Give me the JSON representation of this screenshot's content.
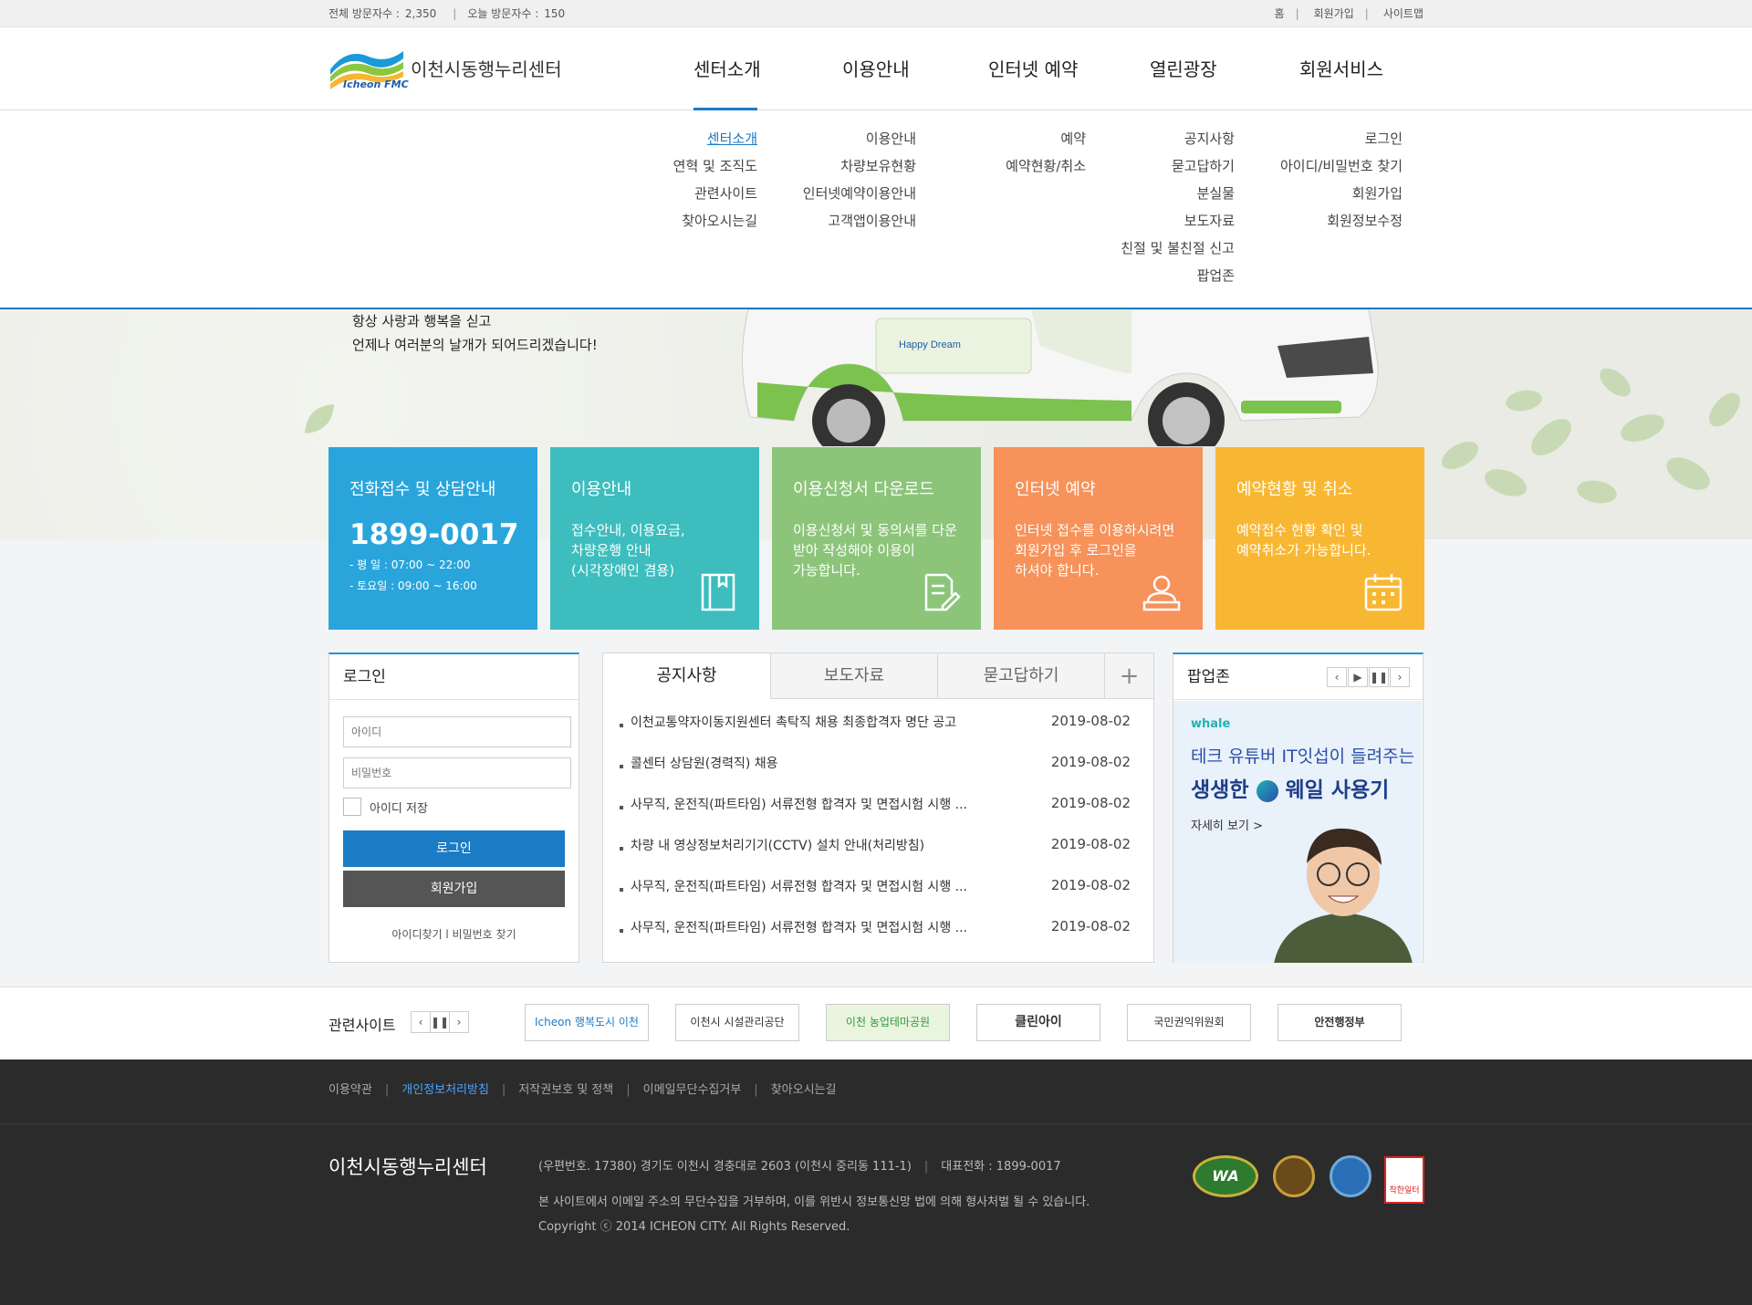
{
  "topbar": {
    "total_visitors_label": "전체 방문자수 :",
    "total_visitors": "2,350",
    "today_visitors_label": "오늘 방문자수 :",
    "today_visitors": "150",
    "links": [
      "홈",
      "회원가입",
      "사이트맵"
    ]
  },
  "header": {
    "logo_en": "Icheon FMC",
    "logo_ko": "이천시동행누리센터",
    "nav": [
      "센터소개",
      "이용안내",
      "인터넷 예약",
      "열린광장",
      "회원서비스"
    ]
  },
  "submenu": {
    "col1": [
      "센터소개",
      "연혁 및 조직도",
      "관련사이트",
      "찾아오시는길"
    ],
    "col2": [
      "이용안내",
      "차량보유현황",
      "인터넷예약이용안내",
      "고객앱이용안내"
    ],
    "col3": [
      "예약",
      "예약현황/취소"
    ],
    "col4": [
      "공지사항",
      "묻고답하기",
      "분실물",
      "보도자료",
      "친절 및 불친절 신고",
      "팝업존"
    ],
    "col5": [
      "로그인",
      "아이디/비밀번호 찾기",
      "회원가입",
      "회원정보수정"
    ]
  },
  "visual": {
    "line1": "항상 사랑과 행복을 싣고",
    "line2": "언제나 여러분의 날개가 되어드리겠습니다!",
    "car_badge": "Happy Dream"
  },
  "quick": {
    "phone_box": {
      "title": "전화접수 및 상담안내",
      "phone": "1899-0017",
      "weekday": "- 평    일 : 07:00 ~ 22:00",
      "saturday": "- 토요일 : 09:00 ~ 16:00",
      "color": "#2aa5dc"
    },
    "guide_box": {
      "title": "이용안내",
      "desc": [
        "접수안내, 이용요금,",
        "차량운행 안내",
        "(시각장애인 겸용)"
      ],
      "color": "#3dbdbd"
    },
    "download_box": {
      "title": "이용신청서 다운로드",
      "desc": [
        "이용신청서 및 동의서를 다운",
        "받아 작성해야 이용이",
        "가능합니다."
      ],
      "color": "#8cc57a"
    },
    "reserve_box": {
      "title": "인터넷 예약",
      "desc": [
        "인터넷 접수를 이용하시려면",
        "회원가입 후 로그인을",
        "하셔야 합니다."
      ],
      "color": "#f6925a"
    },
    "status_box": {
      "title": "예약현황 및 취소",
      "desc": [
        "예약접수 현황 확인 및",
        "예약취소가 가능합니다."
      ],
      "color": "#f8b733"
    }
  },
  "login": {
    "title": "로그인",
    "id_placeholder": "아이디",
    "pw_placeholder": "비밀번호",
    "save_id": "아이디 저장",
    "login_btn": "로그인",
    "join_btn": "회원가입",
    "find": "아이디찾기 l 비밀번호 찾기"
  },
  "board": {
    "tabs": [
      "공지사항",
      "보도자료",
      "묻고답하기",
      "+"
    ],
    "items": [
      {
        "title": "이천교통약자이동지원센터 촉탁직 채용 최종합격자 명단 공고",
        "date": "2019-08-02"
      },
      {
        "title": "콜센터 상담원(경력직) 채용",
        "date": "2019-08-02"
      },
      {
        "title": "사무직, 운전직(파트타임) 서류전형 합격자 및 면접시험 시행 ...",
        "date": "2019-08-02"
      },
      {
        "title": "차량 내 영상정보처리기기(CCTV) 설치 안내(처리방침)",
        "date": "2019-08-02"
      },
      {
        "title": "사무직, 운전직(파트타임) 서류전형 합격자 및 면접시험 시행 ...",
        "date": "2019-08-02"
      },
      {
        "title": "사무직, 운전직(파트타임) 서류전형 합격자 및 면접시험 시행 ...",
        "date": "2019-08-02"
      }
    ]
  },
  "popup": {
    "title": "팝업존",
    "brand": "whale",
    "headline1": "테크 유튜버 IT잇섭이 들려주는",
    "headline2a": "생생한",
    "headline2b": "웨일 사용기",
    "more": "자세히 보기 >"
  },
  "related": {
    "label": "관련사이트",
    "banners": [
      "Icheon 행복도시 이천",
      "이천시 시설관리공단",
      "이천 농업테마공원",
      "클린아이",
      "국민권익위원회",
      "안전행정부"
    ]
  },
  "footer": {
    "links": [
      "이용약관",
      "개인정보처리방침",
      "저작권보호 및 정책",
      "이메일무단수집거부",
      "찾아오시는길"
    ],
    "name": "이천시동행누리센터",
    "address": "(우편번호. 17380) 경기도 이천시 경충대로 2603 (이천시 중리동 111-1)",
    "phone": "대표전화 : 1899-0017",
    "note": "본 사이트에서 이메일 주소의 무단수집을 거부하며, 이를 위반시 정보통신망 법에 의해 형사처벌 될 수 있습니다.",
    "copyright": "Copyright ⓒ 2014 ICHEON CITY. All Rights Reserved.",
    "cert_wa": "WA",
    "cert_red": "착한일터"
  }
}
